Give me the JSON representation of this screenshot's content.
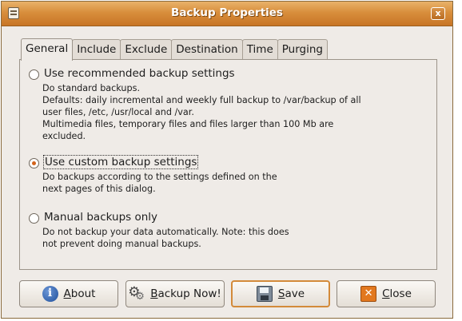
{
  "window": {
    "title": "Backup Properties",
    "close_glyph": "x"
  },
  "tabs": [
    {
      "label": "General",
      "active": true
    },
    {
      "label": "Include",
      "active": false
    },
    {
      "label": "Exclude",
      "active": false
    },
    {
      "label": "Destination",
      "active": false
    },
    {
      "label": "Time",
      "active": false
    },
    {
      "label": "Purging",
      "active": false
    }
  ],
  "options": [
    {
      "label": "Use recommended backup settings",
      "checked": false,
      "description": "Do standard backups.\nDefaults: daily incremental and weekly full backup to /var/backup of all\nuser files, /etc, /usr/local and /var.\nMultimedia files, temporary files and files larger than 100 Mb are\nexcluded."
    },
    {
      "label": "Use custom backup settings",
      "checked": true,
      "description": "Do backups according to the settings defined on the\nnext pages of this dialog."
    },
    {
      "label": "Manual backups only",
      "checked": false,
      "description": "Do not backup your data automatically. Note: this does\nnot prevent doing manual backups."
    }
  ],
  "buttons": {
    "about": {
      "mnemonic": "A",
      "rest": "bout",
      "icon": "info-icon"
    },
    "backup_now": {
      "mnemonic": "B",
      "rest": "ackup Now!",
      "icon": "gears-icon"
    },
    "save": {
      "mnemonic": "S",
      "rest": "ave",
      "icon": "floppy-disk-icon"
    },
    "close": {
      "mnemonic": "C",
      "rest": "lose",
      "icon": "close-icon"
    }
  },
  "colors": {
    "titlebar": "#d88e3c",
    "accent": "#d2631c",
    "window_bg": "#efebe7"
  }
}
